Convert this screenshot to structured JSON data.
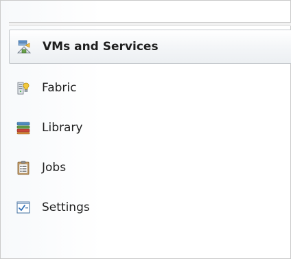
{
  "navigation": {
    "items": [
      {
        "label": "VMs and Services",
        "icon": "vms-and-services-icon",
        "selected": true
      },
      {
        "label": "Fabric",
        "icon": "fabric-icon",
        "selected": false
      },
      {
        "label": "Library",
        "icon": "library-icon",
        "selected": false
      },
      {
        "label": "Jobs",
        "icon": "jobs-icon",
        "selected": false
      },
      {
        "label": "Settings",
        "icon": "settings-icon",
        "selected": false
      }
    ]
  },
  "colors": {
    "selected_border": "#c4c8cc",
    "text": "#1e1e1e",
    "library_red": "#c0392b",
    "library_green": "#4a8a3a",
    "fabric_gold": "#e8b82a"
  }
}
